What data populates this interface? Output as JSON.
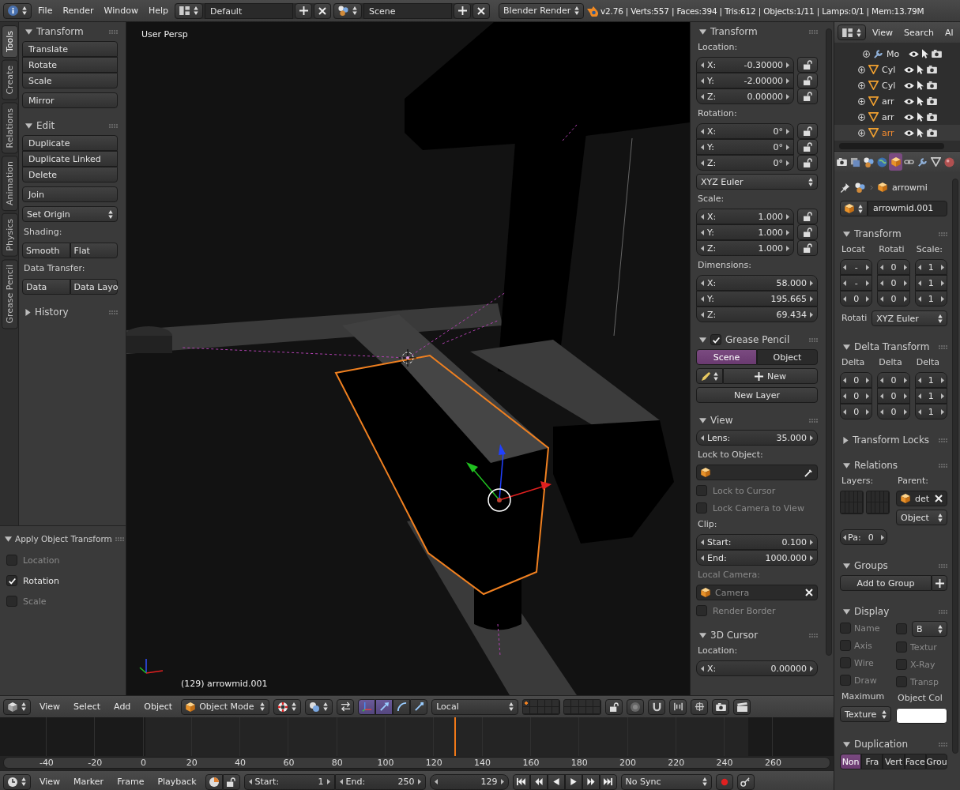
{
  "top_bar": {
    "menus": [
      "File",
      "Render",
      "Window",
      "Help"
    ],
    "screen_layout": "Default",
    "scene": "Scene",
    "render_engine": "Blender Render",
    "stats": "v2.76 | Verts:557 | Faces:394 | Tris:612 | Objects:1/11 | Lamps:0/1 | Mem:13.79M"
  },
  "tool_tabs": [
    {
      "label": "Tools",
      "selected": true
    },
    {
      "label": "Create",
      "selected": false
    },
    {
      "label": "Relations",
      "selected": false
    },
    {
      "label": "Animation",
      "selected": false
    },
    {
      "label": "Physics",
      "selected": false
    },
    {
      "label": "Grease Pencil",
      "selected": false
    }
  ],
  "tool_shelf": {
    "panels": [
      {
        "title": "Transform",
        "expanded": true,
        "items": [
          {
            "kind": "buttons",
            "labels": [
              "Translate",
              "Rotate",
              "Scale"
            ]
          },
          {
            "kind": "buttons",
            "labels": [
              "Mirror"
            ]
          }
        ]
      },
      {
        "title": "Edit",
        "expanded": true,
        "items": [
          {
            "kind": "buttons",
            "labels": [
              "Duplicate",
              "Duplicate Linked",
              "Delete"
            ]
          },
          {
            "kind": "buttons",
            "labels": [
              "Join"
            ]
          },
          {
            "kind": "dropdown",
            "value": "Set Origin"
          },
          {
            "kind": "label",
            "text": "Shading:"
          },
          {
            "kind": "row",
            "labels": [
              "Smooth",
              "Flat"
            ]
          },
          {
            "kind": "label",
            "text": "Data Transfer:"
          },
          {
            "kind": "row",
            "labels": [
              "Data",
              "Data Layo"
            ]
          }
        ]
      },
      {
        "title": "History",
        "expanded": false
      }
    ]
  },
  "operator_panel": {
    "title": "Apply Object Transform",
    "expanded": true,
    "items": [
      {
        "kind": "checkbox",
        "label": "Location",
        "checked": false
      },
      {
        "kind": "checkbox",
        "label": "Rotation",
        "checked": true
      },
      {
        "kind": "checkbox",
        "label": "Scale",
        "checked": false
      }
    ]
  },
  "viewport": {
    "view_name": "User Persp",
    "object_info": "(129) arrowmid.001"
  },
  "properties_region": {
    "panels": [
      {
        "title": "Transform",
        "expanded": true,
        "items": [
          {
            "kind": "label",
            "text": "Location:"
          },
          {
            "kind": "numbers",
            "locks": true,
            "fields": [
              {
                "label": "X:",
                "value": "-0.30000"
              },
              {
                "label": "Y:",
                "value": "-2.00000"
              },
              {
                "label": "Z:",
                "value": "0.00000"
              }
            ]
          },
          {
            "kind": "label",
            "text": "Rotation:"
          },
          {
            "kind": "numbers",
            "locks": true,
            "fields": [
              {
                "label": "X:",
                "value": "0°"
              },
              {
                "label": "Y:",
                "value": "0°"
              },
              {
                "label": "Z:",
                "value": "0°"
              }
            ]
          },
          {
            "kind": "dropdown",
            "value": "XYZ Euler"
          },
          {
            "kind": "label",
            "text": "Scale:"
          },
          {
            "kind": "numbers",
            "locks": true,
            "fields": [
              {
                "label": "X:",
                "value": "1.000"
              },
              {
                "label": "Y:",
                "value": "1.000"
              },
              {
                "label": "Z:",
                "value": "1.000"
              }
            ]
          },
          {
            "kind": "label",
            "text": "Dimensions:"
          },
          {
            "kind": "numbers",
            "fields": [
              {
                "label": "X:",
                "value": "58.000"
              },
              {
                "label": "Y:",
                "value": "195.665"
              },
              {
                "label": "Z:",
                "value": "69.434"
              }
            ]
          }
        ]
      },
      {
        "title": "Grease Pencil",
        "expanded": true,
        "checked": true,
        "items": [
          {
            "kind": "tabs",
            "options": [
              {
                "label": "Scene",
                "selected": true
              },
              {
                "label": "Object",
                "selected": false
              }
            ]
          },
          {
            "kind": "new_datablock",
            "label": "New"
          },
          {
            "kind": "button",
            "label": "New Layer"
          }
        ]
      },
      {
        "title": "View",
        "expanded": true,
        "items": [
          {
            "kind": "numbers",
            "fields": [
              {
                "label": "Lens:",
                "value": "35.000"
              }
            ]
          },
          {
            "kind": "label",
            "text": "Lock to Object:"
          },
          {
            "kind": "object_field",
            "eyedropper": true
          },
          {
            "kind": "checkbox",
            "label": "Lock to Cursor",
            "checked": false
          },
          {
            "kind": "checkbox",
            "label": "Lock Camera to View",
            "checked": false
          },
          {
            "kind": "label",
            "text": "Clip:"
          },
          {
            "kind": "numbers",
            "fields": [
              {
                "label": "Start:",
                "value": "0.100"
              },
              {
                "label": "End:",
                "value": "1000.000"
              }
            ]
          },
          {
            "kind": "label",
            "text": "Local Camera:",
            "disabled": true
          },
          {
            "kind": "object_field",
            "value": "Camera",
            "clearable": true,
            "disabled": true
          },
          {
            "kind": "checkbox",
            "label": "Render Border",
            "checked": false
          }
        ]
      },
      {
        "title": "3D Cursor",
        "expanded": true,
        "items": [
          {
            "kind": "label",
            "text": "Location:"
          },
          {
            "kind": "numbers",
            "fields": [
              {
                "label": "X:",
                "value": "0.00000"
              }
            ]
          }
        ]
      }
    ]
  },
  "view3d_header": {
    "menus": [
      "View",
      "Select",
      "Add",
      "Object"
    ],
    "mode": "Object Mode",
    "manipulators": [
      {
        "kind": "axes",
        "selected": true
      },
      {
        "kind": "translate",
        "selected": true
      },
      {
        "kind": "rotate",
        "selected": false
      },
      {
        "kind": "scale",
        "selected": false
      }
    ],
    "orientation": "Local"
  },
  "timeline": {
    "ruler": [
      "-40",
      "-20",
      "0",
      "20",
      "40",
      "60",
      "80",
      "100",
      "120",
      "140",
      "160",
      "180",
      "200",
      "220",
      "240",
      "260"
    ]
  },
  "timeline_header": {
    "menus": [
      "View",
      "Marker",
      "Frame",
      "Playback"
    ],
    "start": {
      "label": "Start:",
      "value": "1"
    },
    "end": {
      "label": "End:",
      "value": "250"
    },
    "current": "129",
    "sync": "No Sync"
  },
  "outliner": {
    "menus": [
      "View",
      "Search"
    ],
    "filter": "Al",
    "rows": [
      {
        "kind": "modifier",
        "label": "Mo",
        "selected": false
      },
      {
        "kind": "mesh",
        "label": "Cyl",
        "selected": false
      },
      {
        "kind": "mesh",
        "label": "Cyl",
        "selected": false
      },
      {
        "kind": "mesh",
        "label": "arr",
        "selected": false
      },
      {
        "kind": "mesh",
        "label": "arr",
        "selected": false
      },
      {
        "kind": "mesh",
        "label": "arr",
        "selected": true
      }
    ]
  },
  "properties": {
    "context_tabs": [
      {
        "kind": "render",
        "selected": false
      },
      {
        "kind": "render_layers",
        "selected": false
      },
      {
        "kind": "scene",
        "selected": false
      },
      {
        "kind": "world",
        "selected": false
      },
      {
        "kind": "object",
        "selected": true
      },
      {
        "kind": "constraints",
        "selected": false
      },
      {
        "kind": "modifiers",
        "selected": false
      },
      {
        "kind": "data",
        "selected": false
      },
      {
        "kind": "material",
        "selected": false
      }
    ],
    "breadcrumb": "arrowmi",
    "datablock": "arrowmid.001",
    "panels": [
      {
        "title": "Transform",
        "expanded": true,
        "items": [
          {
            "kind": "split",
            "columns": [
              [
                {
                  "kind": "label",
                  "text": "Locat"
                },
                {
                  "kind": "numbers",
                  "fields": [
                    {
                      "value": "-"
                    },
                    {
                      "value": "-"
                    },
                    {
                      "value": "0"
                    }
                  ]
                }
              ],
              [
                {
                  "kind": "label",
                  "text": "Rotati"
                },
                {
                  "kind": "numbers",
                  "fields": [
                    {
                      "value": "0"
                    },
                    {
                      "value": "0"
                    },
                    {
                      "value": "0"
                    }
                  ]
                }
              ],
              [
                {
                  "kind": "label",
                  "text": "Scale:"
                },
                {
                  "kind": "numbers",
                  "fields": [
                    {
                      "value": "1"
                    },
                    {
                      "value": "1"
                    },
                    {
                      "value": "1"
                    }
                  ]
                }
              ]
            ]
          },
          {
            "kind": "hbox",
            "items": [
              {
                "kind": "label",
                "text": "Rotati"
              },
              {
                "kind": "dropdown",
                "value": "XYZ Euler"
              }
            ]
          }
        ]
      },
      {
        "title": "Delta Transform",
        "expanded": true,
        "items": [
          {
            "kind": "split",
            "columns": [
              [
                {
                  "kind": "label",
                  "text": "Delta"
                },
                {
                  "kind": "numbers",
                  "fields": [
                    {
                      "value": "0"
                    },
                    {
                      "value": "0"
                    },
                    {
                      "value": "0"
                    }
                  ]
                }
              ],
              [
                {
                  "kind": "label",
                  "text": "Delta"
                },
                {
                  "kind": "numbers",
                  "fields": [
                    {
                      "value": "0"
                    },
                    {
                      "value": "0"
                    },
                    {
                      "value": "0"
                    }
                  ]
                }
              ],
              [
                {
                  "kind": "label",
                  "text": "Delta"
                },
                {
                  "kind": "numbers",
                  "fields": [
                    {
                      "value": "1"
                    },
                    {
                      "value": "1"
                    },
                    {
                      "value": "1"
                    }
                  ]
                }
              ]
            ]
          }
        ]
      },
      {
        "title": "Transform Locks",
        "expanded": false
      },
      {
        "title": "Relations",
        "expanded": true,
        "items": [
          {
            "kind": "split",
            "columns": [
              [
                {
                  "kind": "label",
                  "text": "Layers:"
                },
                {
                  "kind": "layers"
                }
              ],
              [
                {
                  "kind": "label",
                  "text": "Parent:"
                },
                {
                  "kind": "object_field",
                  "value": "det",
                  "clearable": true
                },
                {
                  "kind": "dropdown",
                  "value": "Object"
                }
              ]
            ]
          },
          {
            "kind": "hbox",
            "items": [
              {
                "kind": "numbers",
                "fields": [
                  {
                    "label": "Pa:",
                    "value": "0"
                  }
                ]
              }
            ]
          }
        ]
      },
      {
        "title": "Groups",
        "expanded": true,
        "items": [
          {
            "kind": "add_button",
            "label": "Add to Group"
          }
        ]
      },
      {
        "title": "Display",
        "expanded": true,
        "items": [
          {
            "kind": "split",
            "columns": [
              [
                {
                  "kind": "checkbox",
                  "label": "Name",
                  "checked": false
                },
                {
                  "kind": "checkbox",
                  "label": "Axis",
                  "checked": false
                },
                {
                  "kind": "checkbox",
                  "label": "Wire",
                  "checked": false
                },
                {
                  "kind": "checkbox",
                  "label": "Draw",
                  "checked": false
                },
                {
                  "kind": "label",
                  "text": "Maximum"
                },
                {
                  "kind": "dropdown",
                  "value": "Texture"
                }
              ],
              [
                {
                  "kind": "hbox",
                  "items": [
                    {
                      "kind": "checkbox",
                      "checked": false
                    },
                    {
                      "kind": "dropdown",
                      "value": "B"
                    }
                  ]
                },
                {
                  "kind": "checkbox",
                  "label": "Textur",
                  "checked": false
                },
                {
                  "kind": "checkbox",
                  "label": "X-Ray",
                  "checked": false
                },
                {
                  "kind": "checkbox",
                  "label": "Transp",
                  "checked": false
                },
                {
                  "kind": "label",
                  "text": "Object Col"
                },
                {
                  "kind": "color",
                  "color": "#ffffff"
                }
              ]
            ]
          }
        ]
      },
      {
        "title": "Duplication",
        "expanded": true,
        "items": [
          {
            "kind": "tabs",
            "options": [
              {
                "label": "Non",
                "selected": true
              },
              {
                "label": "Fra",
                "selected": false
              },
              {
                "label": "Vert",
                "selected": false
              },
              {
                "label": "Face",
                "selected": false
              },
              {
                "label": "Grou",
                "selected": false
              }
            ]
          }
        ]
      }
    ]
  }
}
